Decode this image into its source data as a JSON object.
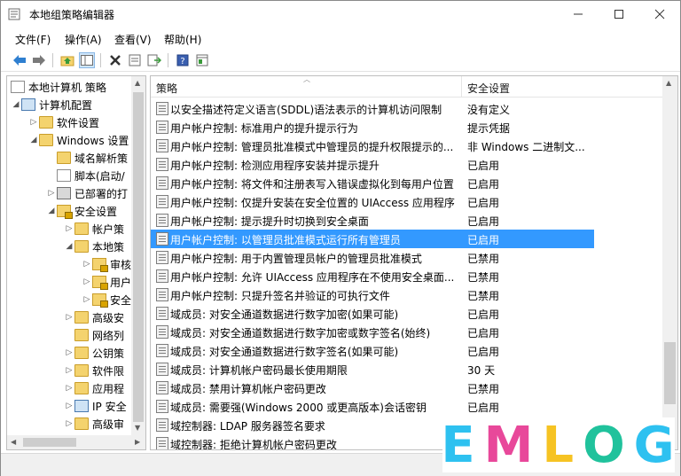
{
  "window": {
    "title": "本地组策略编辑器"
  },
  "menu": [
    "文件(F)",
    "操作(A)",
    "查看(V)",
    "帮助(H)"
  ],
  "tree": {
    "root": "本地计算机 策略",
    "items": [
      {
        "label": "计算机配置",
        "icon": "computer-config-icon"
      },
      {
        "label": "软件设置",
        "icon": "folder-icon"
      },
      {
        "label": "Windows 设置",
        "icon": "folder-icon"
      },
      {
        "label": "域名解析策",
        "icon": "folder-icon"
      },
      {
        "label": "脚本(启动/",
        "icon": "script-icon"
      },
      {
        "label": "已部署的打",
        "icon": "printer-icon"
      },
      {
        "label": "安全设置",
        "icon": "security-icon"
      },
      {
        "label": "帐户策",
        "icon": "folder-icon"
      },
      {
        "label": "本地策",
        "icon": "folder-icon"
      },
      {
        "label": "审核",
        "icon": "folder-lock-icon"
      },
      {
        "label": "用户",
        "icon": "folder-lock-icon"
      },
      {
        "label": "安全",
        "icon": "folder-lock-icon"
      },
      {
        "label": "高级安",
        "icon": "folder-icon"
      },
      {
        "label": "网络列",
        "icon": "folder-icon"
      },
      {
        "label": "公钥策",
        "icon": "folder-icon"
      },
      {
        "label": "软件限",
        "icon": "folder-icon"
      },
      {
        "label": "应用程",
        "icon": "folder-icon"
      },
      {
        "label": "IP 安全",
        "icon": "ip-security-icon"
      },
      {
        "label": "高级审",
        "icon": "folder-icon"
      }
    ]
  },
  "list": {
    "columns": [
      "策略",
      "安全设置"
    ],
    "rows": [
      {
        "name": "以安全描述符定义语言(SDDL)语法表示的计算机访问限制",
        "value": "没有定义"
      },
      {
        "name": "用户帐户控制: 标准用户的提升提示行为",
        "value": "提示凭据"
      },
      {
        "name": "用户帐户控制: 管理员批准模式中管理员的提升权限提示的...",
        "value": "非 Windows 二进制文..."
      },
      {
        "name": "用户帐户控制: 检测应用程序安装并提示提升",
        "value": "已启用"
      },
      {
        "name": "用户帐户控制: 将文件和注册表写入错误虚拟化到每用户位置",
        "value": "已启用"
      },
      {
        "name": "用户帐户控制: 仅提升安装在安全位置的 UIAccess 应用程序",
        "value": "已启用"
      },
      {
        "name": "用户帐户控制: 提示提升时切换到安全桌面",
        "value": "已启用"
      },
      {
        "name": "用户帐户控制: 以管理员批准模式运行所有管理员",
        "value": "已启用"
      },
      {
        "name": "用户帐户控制: 用于内置管理员帐户的管理员批准模式",
        "value": "已禁用"
      },
      {
        "name": "用户帐户控制: 允许 UIAccess 应用程序在不使用安全桌面...",
        "value": "已禁用"
      },
      {
        "name": "用户帐户控制: 只提升签名并验证的可执行文件",
        "value": "已禁用"
      },
      {
        "name": "域成员: 对安全通道数据进行数字加密(如果可能)",
        "value": "已启用"
      },
      {
        "name": "域成员: 对安全通道数据进行数字加密或数字签名(始终)",
        "value": "已启用"
      },
      {
        "name": "域成员: 对安全通道数据进行数字签名(如果可能)",
        "value": "已启用"
      },
      {
        "name": "域成员: 计算机帐户密码最长使用期限",
        "value": "30 天"
      },
      {
        "name": "域成员: 禁用计算机帐户密码更改",
        "value": "已禁用"
      },
      {
        "name": "域成员: 需要强(Windows 2000 或更高版本)会话密钥",
        "value": "已启用"
      },
      {
        "name": "域控制器: LDAP 服务器签名要求",
        "value": ""
      },
      {
        "name": "域控制器: 拒绝计算机帐户密码更改",
        "value": ""
      }
    ],
    "selected_index": 7
  },
  "watermark": {
    "letters": [
      "E",
      "M",
      "L",
      "O",
      "G"
    ],
    "colors": [
      "#2ec1f0",
      "#e8489a",
      "#f6c323",
      "#20c29c",
      "#2ec1f0"
    ]
  },
  "colors": {
    "selection": "#3399ff"
  }
}
